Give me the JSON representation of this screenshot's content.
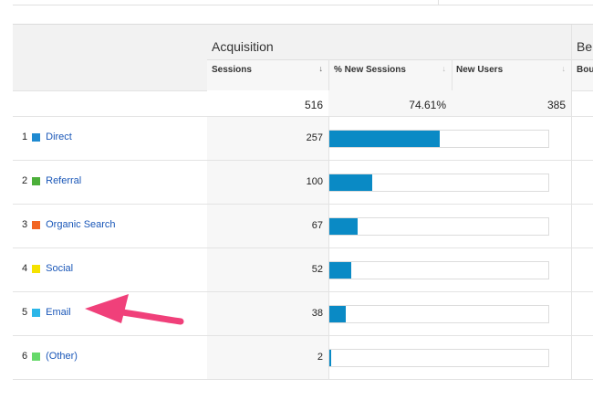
{
  "header": {
    "group_acquisition": "Acquisition",
    "group_behavior": "Be",
    "col_sessions": "Sessions",
    "col_sessions_sort": "↓",
    "col_new_sessions": "% New Sessions",
    "col_new_users": "New Users",
    "col_bounce": "Bou",
    "sort_indicator": "↓"
  },
  "totals": {
    "sessions": "516",
    "new_sessions_pct": "74.61%",
    "new_users": "385"
  },
  "rows": [
    {
      "index": "1",
      "channel": "Direct",
      "sessions": "257",
      "swatch_color": "#1f8ad1"
    },
    {
      "index": "2",
      "channel": "Referral",
      "sessions": "100",
      "swatch_color": "#4caf3a"
    },
    {
      "index": "3",
      "channel": "Organic Search",
      "sessions": "67",
      "swatch_color": "#f26522"
    },
    {
      "index": "4",
      "channel": "Social",
      "sessions": "52",
      "swatch_color": "#f5e200"
    },
    {
      "index": "5",
      "channel": "Email",
      "sessions": "38",
      "swatch_color": "#2bb6e8"
    },
    {
      "index": "6",
      "channel": "(Other)",
      "sessions": "2",
      "swatch_color": "#66d96a"
    }
  ],
  "colors": {
    "bar": "#0a8ac5",
    "link": "#1a57b8",
    "annotation_arrow": "#f0407a"
  }
}
